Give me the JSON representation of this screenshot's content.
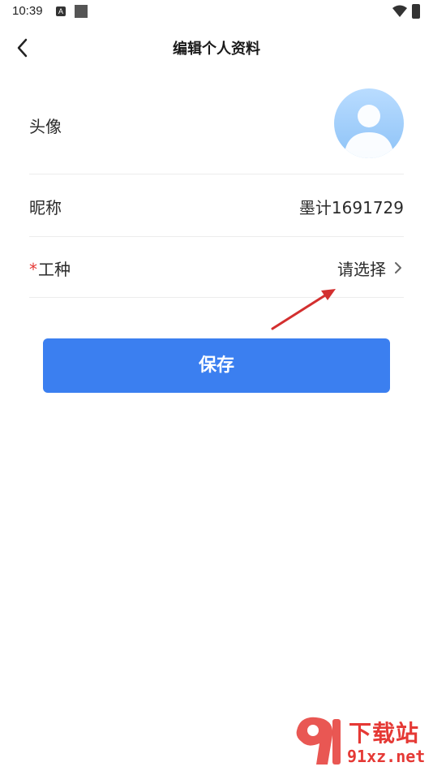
{
  "status_bar": {
    "time": "10:39",
    "notification_icon": "a-icon",
    "notification_icon_letter": "A"
  },
  "header": {
    "title": "编辑个人资料",
    "back_icon": "chevron-left-icon"
  },
  "form": {
    "avatar_label": "头像",
    "nickname_label": "昵称",
    "nickname_value": "墨计1691729",
    "job_required_mark": "*",
    "job_label": "工种",
    "job_placeholder": "请选择"
  },
  "actions": {
    "save_label": "保存"
  },
  "colors": {
    "primary": "#3b7ff0",
    "required": "#e53935",
    "annotation_arrow": "#d32f2f"
  },
  "watermark": {
    "title": "下载站",
    "site": "91xz.net",
    "logo_text": "91"
  }
}
